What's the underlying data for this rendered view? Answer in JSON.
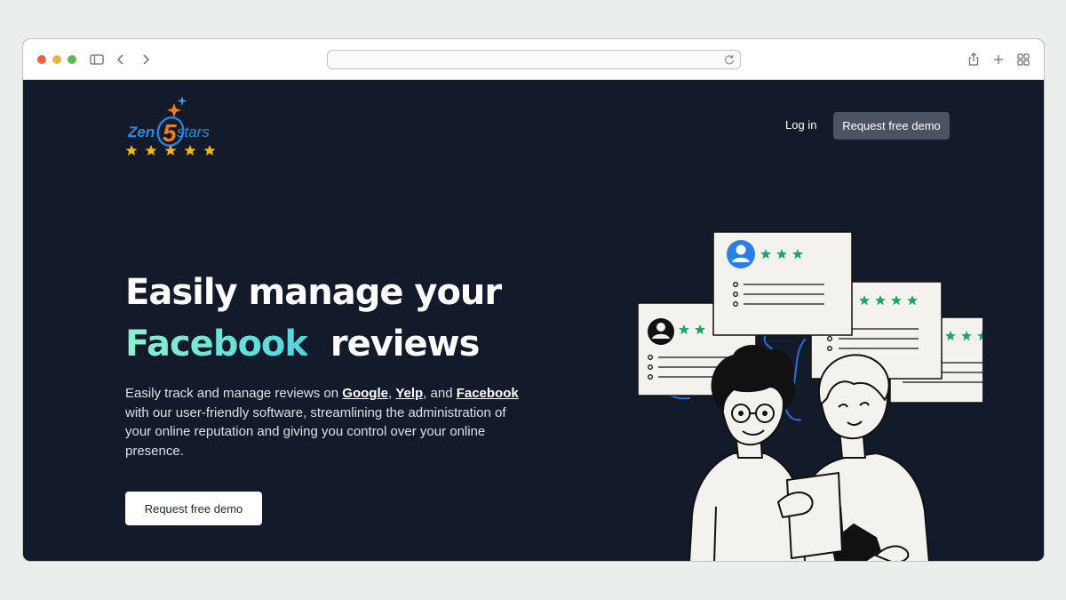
{
  "browser": {
    "url": "",
    "icons": [
      "sidebar-icon",
      "back-icon",
      "forward-icon",
      "reload-icon",
      "share-icon",
      "new-tab-icon",
      "tab-overview-icon"
    ]
  },
  "logo": {
    "text_zen": "Zen",
    "text_five": "5",
    "text_stars": "stars"
  },
  "nav": {
    "login": "Log in",
    "demo": "Request free demo"
  },
  "hero": {
    "title_line1": "Easily manage your",
    "title_accent": "Facebook",
    "title_end": "reviews",
    "desc_pre": "Easily track and manage reviews on ",
    "link_google": "Google",
    "sep1": ", ",
    "link_yelp": "Yelp",
    "sep2": ", and ",
    "link_facebook": "Facebook",
    "desc_post": " with our user-friendly software, streamlining the administration of your online reputation and giving you control over your online presence.",
    "cta": "Request free demo"
  },
  "colors": {
    "page_bg": "#131a2a",
    "accent_gradient_start": "#8ef0cf",
    "accent_gradient_end": "#4fd6df",
    "star_yellow": "#f5b800",
    "review_star_green": "#1ea46b",
    "nav_button": "#4a5263"
  }
}
